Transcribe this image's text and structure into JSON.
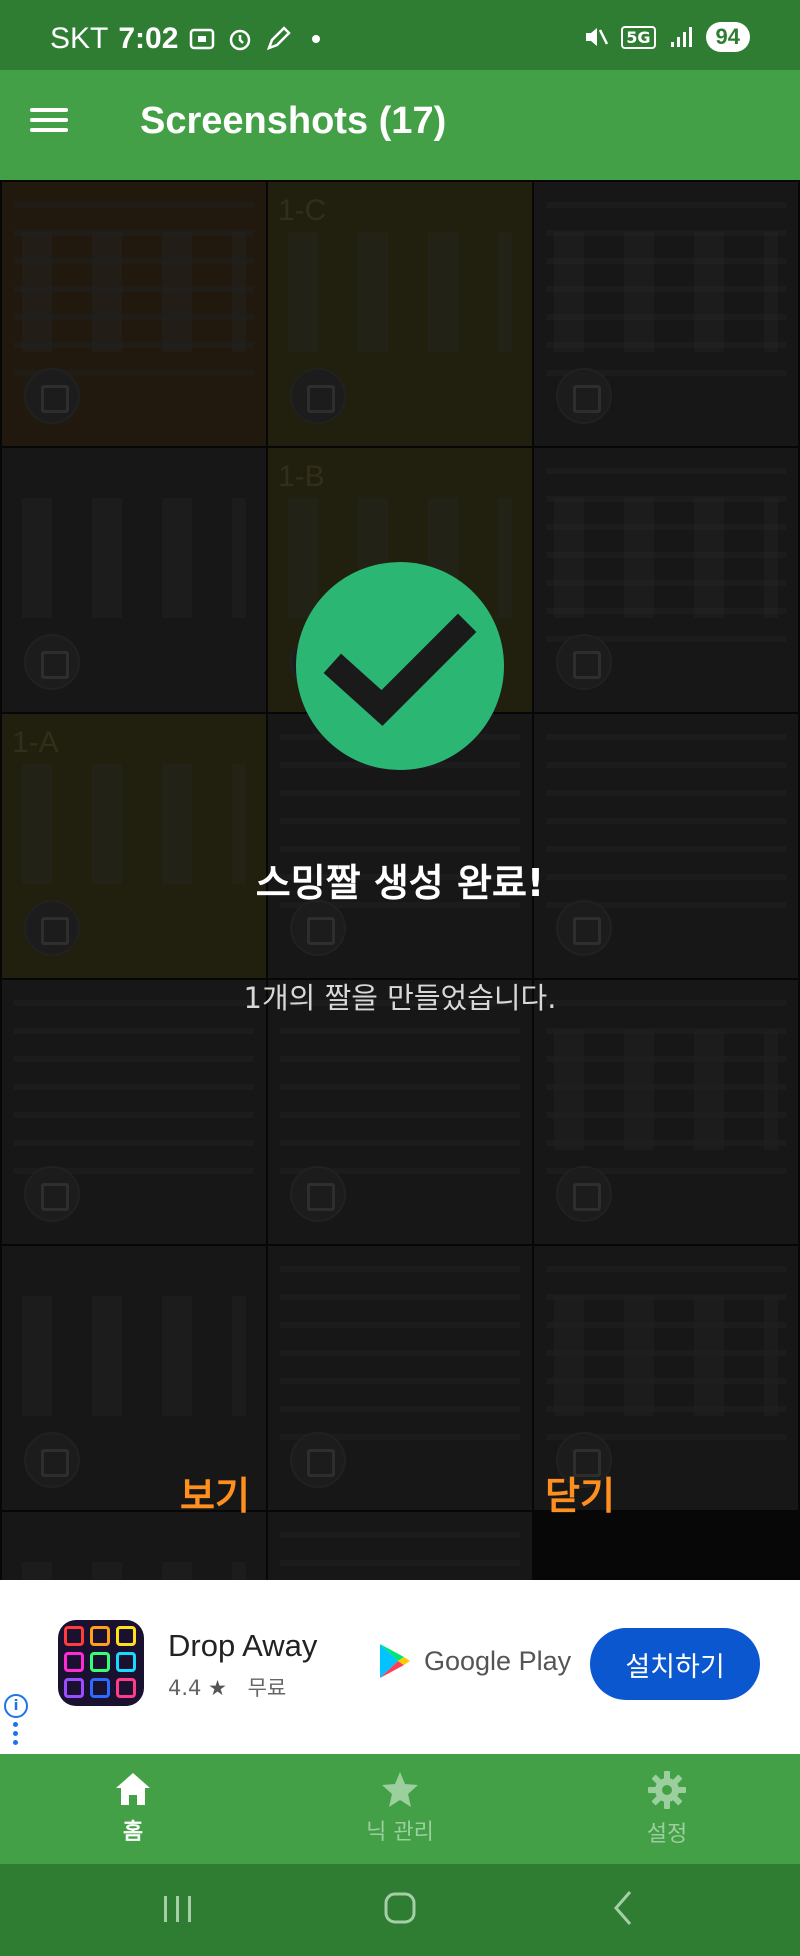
{
  "status_bar": {
    "carrier": "SKT",
    "time": "7:02",
    "network": "5G",
    "battery": "94"
  },
  "app_bar": {
    "title": "Screenshots (17)"
  },
  "grid": {
    "tags": [
      "1-C",
      "1-B",
      "1-A"
    ]
  },
  "dialog": {
    "title": "스밍짤 생성 완료!",
    "message": "1개의 짤을 만들었습니다.",
    "view_button": "보기",
    "close_button": "닫기",
    "accent_color": "#ff8f1f",
    "check_color": "#2bb673"
  },
  "ad": {
    "app_name": "Drop Away",
    "rating": "4.4",
    "price": "무료",
    "store": "Google Play",
    "install_button": "설치하기",
    "info_icon": "i"
  },
  "bottom_nav": {
    "items": [
      {
        "label": "홈",
        "icon": "home-icon",
        "active": true
      },
      {
        "label": "닉 관리",
        "icon": "star-icon",
        "active": false
      },
      {
        "label": "설정",
        "icon": "gear-icon",
        "active": false
      }
    ]
  },
  "colors": {
    "primary": "#43a047",
    "primary_dark": "#2e7d32",
    "install_blue": "#0b57d0"
  }
}
